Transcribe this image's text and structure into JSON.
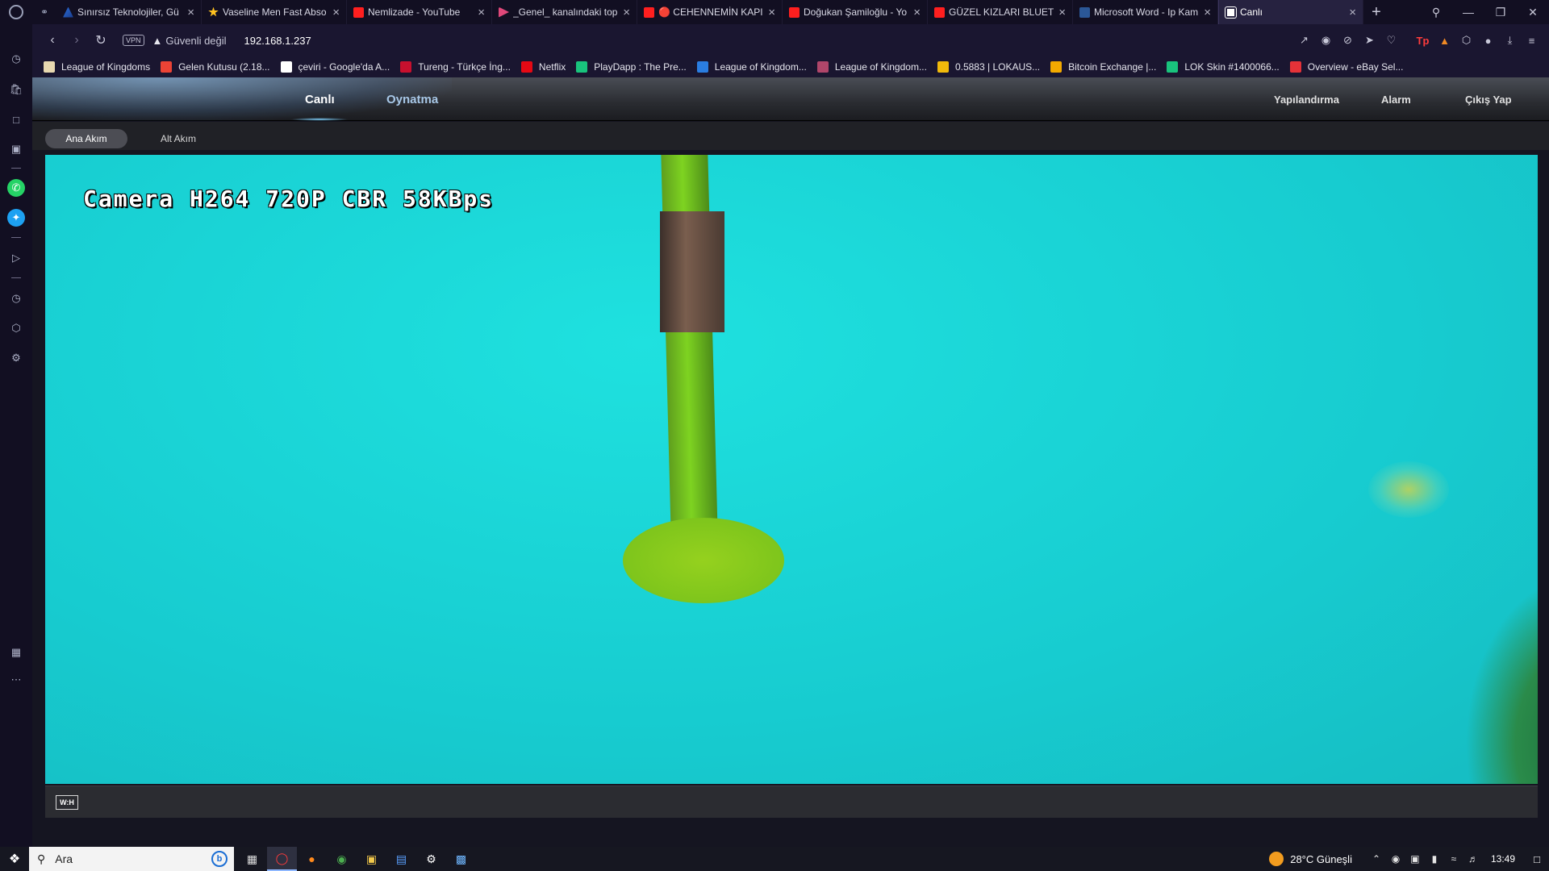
{
  "browser": {
    "tabs": [
      {
        "title": "Sınırsız Teknolojiler, Gü",
        "favicon": "triangle-logo-icon"
      },
      {
        "title": "Vaseline Men Fast Abso",
        "favicon": "walmart-star-icon"
      },
      {
        "title": "Nemlizade - YouTube",
        "favicon": "youtube-icon"
      },
      {
        "title": "_Genel_ kanalındaki top",
        "favicon": "play-icon"
      },
      {
        "title": "🔴 CEHENNEMİN KAPI",
        "favicon": "youtube-icon"
      },
      {
        "title": "Doğukan Şamiloğlu - Yo",
        "favicon": "youtube-icon"
      },
      {
        "title": "GÜZEL KIZLARI BLUETO",
        "favicon": "youtube-icon"
      },
      {
        "title": "Microsoft Word - Ip Kam",
        "favicon": "word-icon"
      },
      {
        "title": "Canlı",
        "favicon": "globe-icon",
        "active": true
      }
    ],
    "new_tab_symbol": "+",
    "address": {
      "vpn_label": "VPN",
      "security_label": "Güvenli değil",
      "url": "192.168.1.237"
    },
    "bookmarks": [
      {
        "label": "League of Kingdoms",
        "icon_color": "#e8d8b0"
      },
      {
        "label": "Gelen Kutusu (2.18...",
        "icon_color": "#ea4335"
      },
      {
        "label": "çeviri - Google'da A...",
        "icon_color": "#ffffff"
      },
      {
        "label": "Tureng - Türkçe İng...",
        "icon_color": "#c8102e"
      },
      {
        "label": "Netflix",
        "icon_color": "#e50914"
      },
      {
        "label": "PlayDapp : The Pre...",
        "icon_color": "#19c37d"
      },
      {
        "label": "League of Kingdom...",
        "icon_color": "#2a7de1"
      },
      {
        "label": "League of Kingdom...",
        "icon_color": "#b0466a"
      },
      {
        "label": "0.5883 | LOKAUS...",
        "icon_color": "#f0b90b"
      },
      {
        "label": "Bitcoin Exchange |...",
        "icon_color": "#f2a900"
      },
      {
        "label": "LOK Skin #1400066...",
        "icon_color": "#19c37d"
      },
      {
        "label": "Overview - eBay Sel...",
        "icon_color": "#e53238"
      }
    ]
  },
  "camera_app": {
    "nav_main": {
      "live": "Canlı",
      "playback": "Oynatma"
    },
    "nav_right": {
      "config": "Yapılandırma",
      "alarm": "Alarm",
      "logout": "Çıkış Yap"
    },
    "streams": {
      "main": "Ana Akım",
      "sub": "Alt Akım",
      "selected": "main"
    },
    "osd_text": "Camera H264 720P CBR 58KBps",
    "ratio_button": "W:H"
  },
  "taskbar": {
    "search_placeholder": "Ara",
    "weather": "28°C Güneşli",
    "time": "13:49"
  }
}
